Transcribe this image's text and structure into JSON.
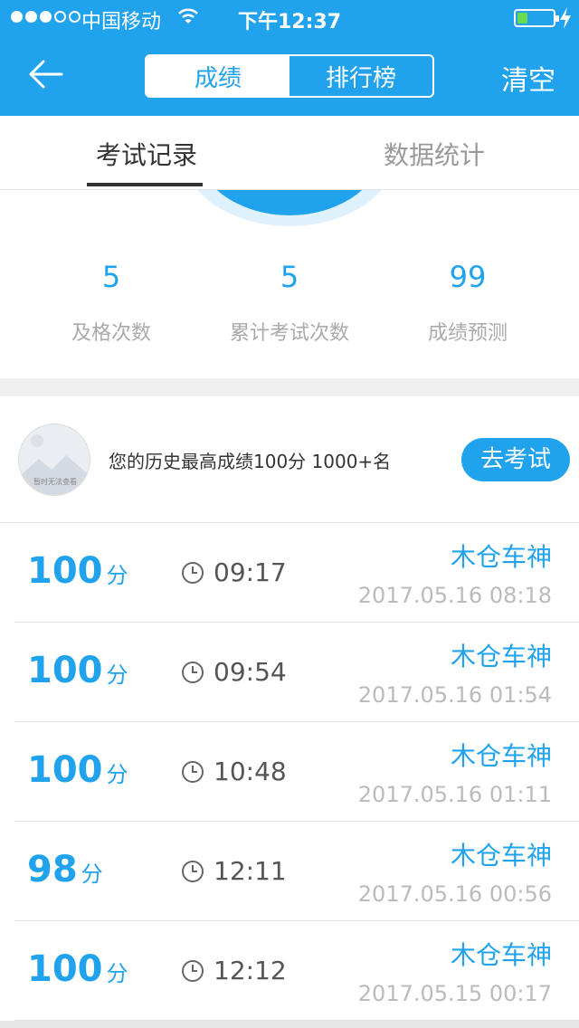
{
  "status_bar": {
    "carrier": "中国移动",
    "time": "下午12:37",
    "battery_level": 0.3,
    "battery_color": "#69d94f",
    "signal_bars_on": 3,
    "signal_bars_total": 5
  },
  "nav": {
    "segments": [
      "成绩",
      "排行榜"
    ],
    "active_segment": 0,
    "clear_label": "清空",
    "accent_color": "#20a3ec"
  },
  "tabs": {
    "items": [
      "考试记录",
      "数据统计"
    ],
    "active": 0
  },
  "stats": [
    {
      "value": "5",
      "label": "及格次数"
    },
    {
      "value": "5",
      "label": "累计考试次数"
    },
    {
      "value": "99",
      "label": "成绩预测"
    }
  ],
  "best": {
    "text": "您的历史最高成绩100分  1000+名",
    "button_label": "去考试",
    "avatar_placeholder": "暂时无法查看"
  },
  "records": [
    {
      "score": "100",
      "unit": "分",
      "duration": "09:17",
      "name": "木仓车神",
      "date": "2017.05.16 08:18"
    },
    {
      "score": "100",
      "unit": "分",
      "duration": "09:54",
      "name": "木仓车神",
      "date": "2017.05.16 01:54"
    },
    {
      "score": "100",
      "unit": "分",
      "duration": "10:48",
      "name": "木仓车神",
      "date": "2017.05.16 01:11"
    },
    {
      "score": "98",
      "unit": "分",
      "duration": "12:11",
      "name": "木仓车神",
      "date": "2017.05.16 00:56"
    },
    {
      "score": "100",
      "unit": "分",
      "duration": "12:12",
      "name": "木仓车神",
      "date": "2017.05.15 00:17"
    }
  ]
}
